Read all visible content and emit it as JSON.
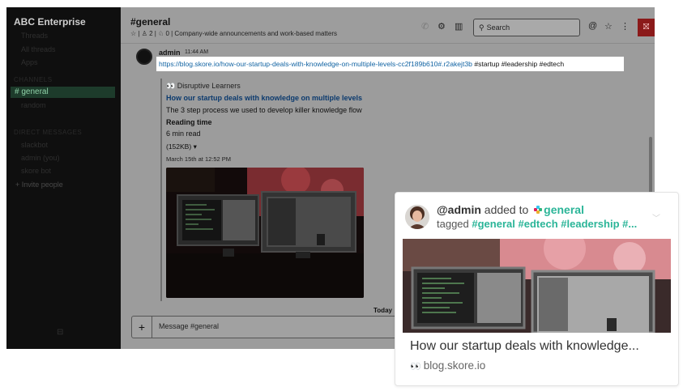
{
  "sidebar": {
    "workspace_name": "ABC Enterprise",
    "items": [
      "Threads",
      "All threads",
      "Apps"
    ],
    "channels_header": "CHANNELS",
    "active_channel": "# general",
    "other_channels": [
      "random"
    ],
    "dm_header": "DIRECT MESSAGES",
    "dms": [
      "slackbot",
      "admin (you)",
      "skore bot"
    ],
    "invite_label": "+ Invite people"
  },
  "header": {
    "channel_title": "#general",
    "meta": "☆ | ♙ 2 | ♘ 0 | Company-wide announcements and work-based matters",
    "search_placeholder": "Search"
  },
  "message": {
    "author": "admin",
    "time": "11:44 AM",
    "url": "https://blog.skore.io/how-our-startup-deals-with-knowledge-on-multiple-levels-cc2f189b610#.r2akejt3b",
    "hashtags": "#startup #leadership #edtech",
    "attachment": {
      "source": "Disruptive Learners",
      "title": "How our startup deals with knowledge on multiple levels",
      "description": "The 3 step process we used to develop killer knowledge flow",
      "reading_time_label": "Reading time",
      "reading_time_value": "6 min read",
      "size": "(152KB)",
      "date": "March 15th at 12:52 PM"
    }
  },
  "divider": {
    "today": "Today"
  },
  "composer": {
    "placeholder": "Message #general"
  },
  "card": {
    "user": "@admin",
    "added_to": "added to",
    "channel": "general",
    "tagged_label": "tagged",
    "tags": [
      "#general",
      "#edtech",
      "#leadership",
      "#..."
    ],
    "title": "How our startup deals with knowledge...",
    "site": "blog.skore.io"
  },
  "colors": {
    "accent_green": "#2bb598",
    "link_blue": "#1264a3"
  }
}
